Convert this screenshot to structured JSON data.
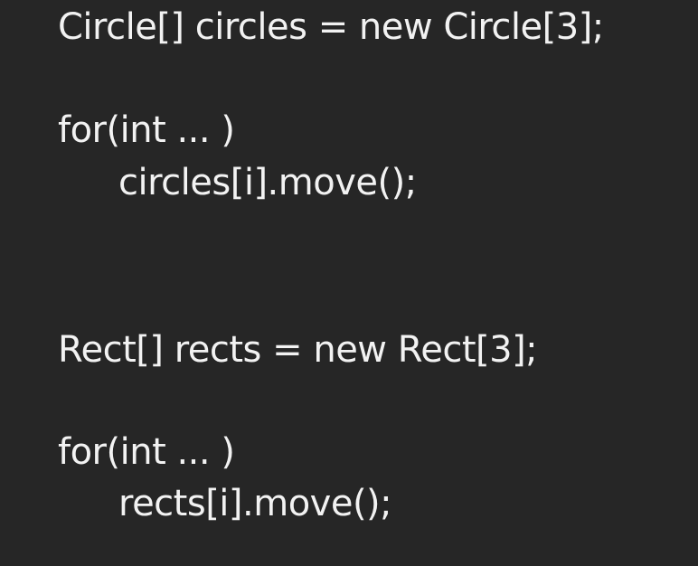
{
  "slide": {
    "lines": [
      "Circle[] circles = new Circle[3];",
      "for(int ... )",
      "circles[i].move();",
      "Rect[] rects = new Rect[3];",
      "for(int ... )",
      "rects[i].move();"
    ]
  }
}
